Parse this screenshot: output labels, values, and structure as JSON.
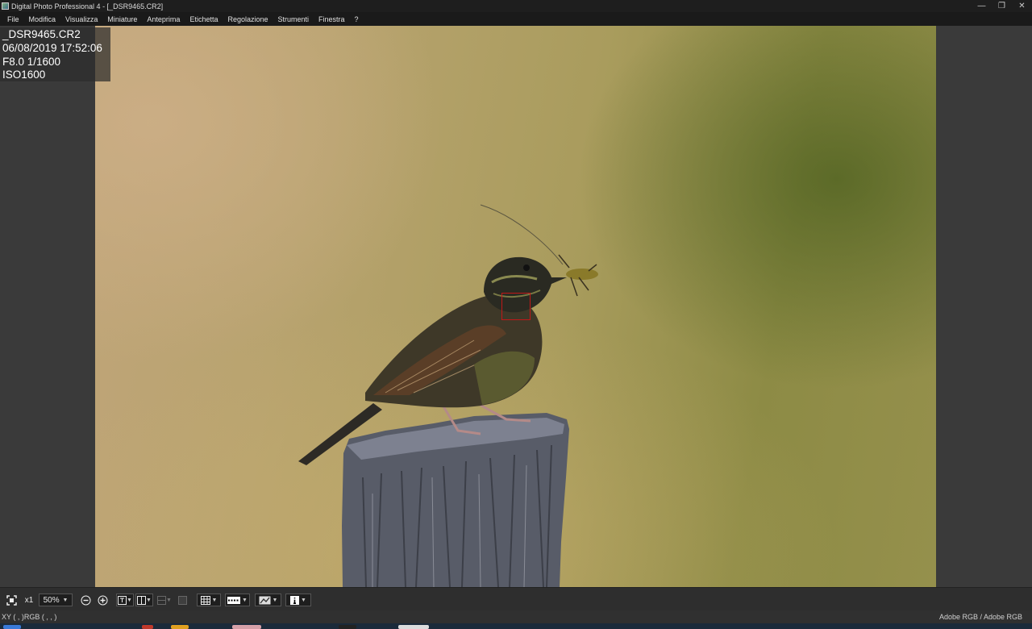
{
  "window": {
    "title": "Digital Photo Professional 4 - [_DSR9465.CR2]",
    "minimize_glyph": "—",
    "restore_glyph": "❐",
    "close_glyph": "✕"
  },
  "menu": [
    "File",
    "Modifica",
    "Visualizza",
    "Miniature",
    "Anteprima",
    "Etichetta",
    "Regolazione",
    "Strumenti",
    "Finestra",
    "?"
  ],
  "info_overlay": {
    "filename": "_DSR9465.CR2",
    "datetime": "06/08/2019 17:52:06",
    "exposure": "F8.0 1/1600",
    "iso": "ISO1600"
  },
  "toolbar": {
    "zoom_multiplier": "x1",
    "zoom_percent": "50%",
    "icons": [
      "fit-screen-icon",
      "zoom-out-icon",
      "zoom-in-icon",
      "single-view-icon",
      "compare-view-icon",
      "split-view-icon",
      "split-view-alt-icon",
      "grid-icon",
      "highlight-warning-icon",
      "af-point-icon",
      "info-icon"
    ]
  },
  "status": {
    "xy_readout": "XY (     ,     )RGB (     ,     ,     )",
    "color_space": "Adobe RGB / Adobe RGB"
  },
  "colors": {
    "focus_box": "#c01818",
    "titlebar_bg": "#1e1e1e",
    "canvas_bg": "#3a3a3a"
  }
}
